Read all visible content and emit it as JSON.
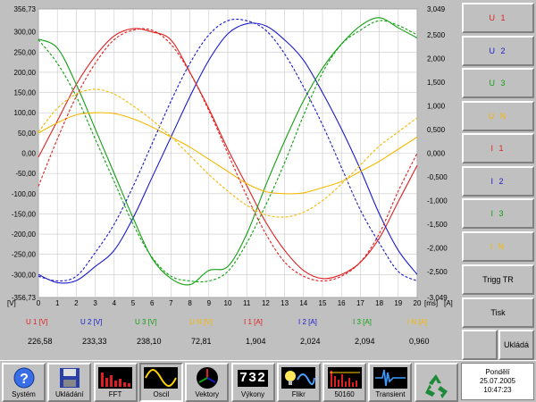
{
  "colors": {
    "U1": "#e02020",
    "U2": "#1a1acc",
    "U3": "#12a012",
    "UN": "#f5b800",
    "I1": "#e02020",
    "I2": "#1a1acc",
    "I3": "#12a012",
    "IN": "#f5b800"
  },
  "chart_data": {
    "type": "line",
    "xlabel": "[ms]",
    "ylabel_left": "[V]",
    "ylabel_right": "[A]",
    "xlim": [
      0,
      20
    ],
    "ylim_left": [
      -356.73,
      356.73
    ],
    "ylim_right": [
      -3.049,
      3.049
    ],
    "x_ticks": [
      "0",
      "1",
      "2",
      "3",
      "4",
      "5",
      "6",
      "7",
      "8",
      "9",
      "10",
      "11",
      "12",
      "13",
      "14",
      "15",
      "16",
      "17",
      "18",
      "19",
      "20"
    ],
    "y_ticks_left": [
      "356,73",
      "300,00",
      "250,00",
      "200,00",
      "150,00",
      "100,00",
      "50,00",
      "0,00",
      "-50,00",
      "-100,00",
      "-150,00",
      "-200,00",
      "-250,00",
      "-300,00",
      "-356,73"
    ],
    "y_ticks_right": [
      "3,049",
      "2,500",
      "2,000",
      "1,500",
      "1,000",
      "0,500",
      "0,000",
      "-0,500",
      "-1,000",
      "-1,500",
      "-2,000",
      "-2,500",
      "-3,049"
    ],
    "grid": true,
    "series": [
      {
        "name": "U 1",
        "axis": "left",
        "style": "solid",
        "x": [
          0,
          1,
          2,
          3,
          4,
          5,
          6,
          7,
          8,
          9,
          10,
          11,
          12,
          13,
          14,
          15,
          16,
          17,
          18,
          19,
          20
        ],
        "y": [
          -10,
          80,
          170,
          240,
          290,
          308,
          300,
          280,
          200,
          110,
          10,
          -80,
          -170,
          -240,
          -290,
          -310,
          -300,
          -270,
          -210,
          -120,
          -30
        ]
      },
      {
        "name": "U 2",
        "axis": "left",
        "style": "solid",
        "x": [
          0,
          1,
          2,
          3,
          4,
          5,
          6,
          7,
          8,
          9,
          10,
          11,
          12,
          13,
          14,
          15,
          16,
          17,
          18,
          19,
          20
        ],
        "y": [
          -300,
          -320,
          -315,
          -280,
          -240,
          -160,
          -60,
          40,
          140,
          230,
          295,
          320,
          315,
          280,
          230,
          150,
          60,
          -40,
          -150,
          -240,
          -300
        ]
      },
      {
        "name": "U 3",
        "axis": "left",
        "style": "solid",
        "x": [
          0,
          1,
          2,
          3,
          4,
          5,
          6,
          7,
          8,
          9,
          10,
          11,
          12,
          13,
          14,
          15,
          16,
          17,
          18,
          19,
          20
        ],
        "y": [
          282,
          260,
          170,
          60,
          -50,
          -160,
          -260,
          -310,
          -325,
          -290,
          -280,
          -200,
          -80,
          30,
          130,
          210,
          270,
          315,
          335,
          310,
          285
        ]
      },
      {
        "name": "U N",
        "axis": "left",
        "style": "solid",
        "x": [
          0,
          1,
          2,
          3,
          4,
          5,
          6,
          7,
          8,
          9,
          10,
          11,
          12,
          13,
          14,
          15,
          16,
          17,
          18,
          19,
          20
        ],
        "y": [
          50,
          75,
          95,
          100,
          98,
          85,
          65,
          40,
          15,
          -15,
          -45,
          -75,
          -95,
          -100,
          -98,
          -85,
          -70,
          -45,
          -20,
          10,
          40
        ]
      },
      {
        "name": "I 1",
        "axis": "right",
        "style": "dashed",
        "x": [
          0,
          1,
          2,
          3,
          4,
          5,
          6,
          7,
          8,
          9,
          10,
          11,
          12,
          13,
          14,
          15,
          16,
          17,
          18,
          19,
          20
        ],
        "y": [
          -0.7,
          0.3,
          1.2,
          1.9,
          2.4,
          2.6,
          2.6,
          2.3,
          1.7,
          0.9,
          0.0,
          -0.9,
          -1.7,
          -2.3,
          -2.6,
          -2.7,
          -2.6,
          -2.3,
          -1.7,
          -0.8,
          0.0
        ]
      },
      {
        "name": "I 2",
        "axis": "right",
        "style": "dashed",
        "x": [
          0,
          1,
          2,
          3,
          4,
          5,
          6,
          7,
          8,
          9,
          10,
          11,
          12,
          13,
          14,
          15,
          16,
          17,
          18,
          19,
          20
        ],
        "y": [
          -2.6,
          -2.7,
          -2.6,
          -2.1,
          -1.5,
          -0.7,
          0.2,
          1.1,
          1.9,
          2.5,
          2.8,
          2.8,
          2.6,
          2.1,
          1.4,
          0.6,
          -0.3,
          -1.2,
          -1.9,
          -2.5,
          -2.7
        ]
      },
      {
        "name": "I 3",
        "axis": "right",
        "style": "dashed",
        "x": [
          0,
          1,
          2,
          3,
          4,
          5,
          6,
          7,
          8,
          9,
          10,
          11,
          12,
          13,
          14,
          15,
          16,
          17,
          18,
          19,
          20
        ],
        "y": [
          2.4,
          1.9,
          1.2,
          0.3,
          -0.6,
          -1.5,
          -2.2,
          -2.6,
          -2.7,
          -2.7,
          -2.5,
          -1.9,
          -1.1,
          -0.2,
          0.8,
          1.7,
          2.3,
          2.6,
          2.8,
          2.7,
          2.5
        ]
      },
      {
        "name": "I N",
        "axis": "right",
        "style": "dashed",
        "x": [
          0,
          1,
          2,
          3,
          4,
          5,
          6,
          7,
          8,
          9,
          10,
          11,
          12,
          13,
          14,
          15,
          16,
          17,
          18,
          19,
          20
        ],
        "y": [
          0.45,
          0.95,
          1.25,
          1.35,
          1.25,
          1.0,
          0.7,
          0.35,
          -0.05,
          -0.45,
          -0.8,
          -1.1,
          -1.3,
          -1.35,
          -1.25,
          -1.0,
          -0.65,
          -0.25,
          0.15,
          0.45,
          0.75
        ]
      }
    ]
  },
  "readout": {
    "items": [
      {
        "label": "U 1 [V]",
        "value": "226,58",
        "color_key": "U1"
      },
      {
        "label": "U 2 [V]",
        "value": "233,33",
        "color_key": "U2"
      },
      {
        "label": "U 3 [V]",
        "value": "238,10",
        "color_key": "U3"
      },
      {
        "label": "U N [V]",
        "value": "72,81",
        "color_key": "UN"
      },
      {
        "label": "I 1 [A]",
        "value": "1,904",
        "color_key": "I1"
      },
      {
        "label": "I 2 [A]",
        "value": "2,024",
        "color_key": "I2"
      },
      {
        "label": "I 3 [A]",
        "value": "2,094",
        "color_key": "I3"
      },
      {
        "label": "I N [A]",
        "value": "0,960",
        "color_key": "IN"
      }
    ]
  },
  "side_panel": {
    "channels": [
      {
        "label": "U 1",
        "color_key": "U1"
      },
      {
        "label": "U 2",
        "color_key": "U2"
      },
      {
        "label": "U 3",
        "color_key": "U3"
      },
      {
        "label": "U N",
        "color_key": "UN"
      },
      {
        "label": "I 1",
        "color_key": "I1"
      },
      {
        "label": "I 2",
        "color_key": "I2"
      },
      {
        "label": "I 3",
        "color_key": "I3"
      },
      {
        "label": "I N",
        "color_key": "IN"
      }
    ],
    "trigger_label": "Trigg TR",
    "print_label": "Tisk",
    "save_label": "Ukládá"
  },
  "taskbar": {
    "buttons": [
      {
        "label": "Systém",
        "icon": "help-icon"
      },
      {
        "label": "Ukládání",
        "icon": "floppy-disk-icon"
      },
      {
        "label": "FFT",
        "icon": "fft-bars-icon"
      },
      {
        "label": "Oscil",
        "icon": "sine-wave-icon",
        "active": true
      },
      {
        "label": "Vektory",
        "icon": "phasor-icon"
      },
      {
        "label": "Výkony",
        "icon": "digits-icon",
        "digits": "732"
      },
      {
        "label": "Flikr",
        "icon": "flicker-bulb-icon"
      },
      {
        "label": "50160",
        "icon": "harmonics-icon"
      },
      {
        "label": "Transient",
        "icon": "transient-icon"
      },
      {
        "label": "",
        "icon": "recycle-icon"
      }
    ],
    "clock": {
      "day": "Pondělí",
      "date": "25.07.2005",
      "time": "10:47:23"
    }
  }
}
